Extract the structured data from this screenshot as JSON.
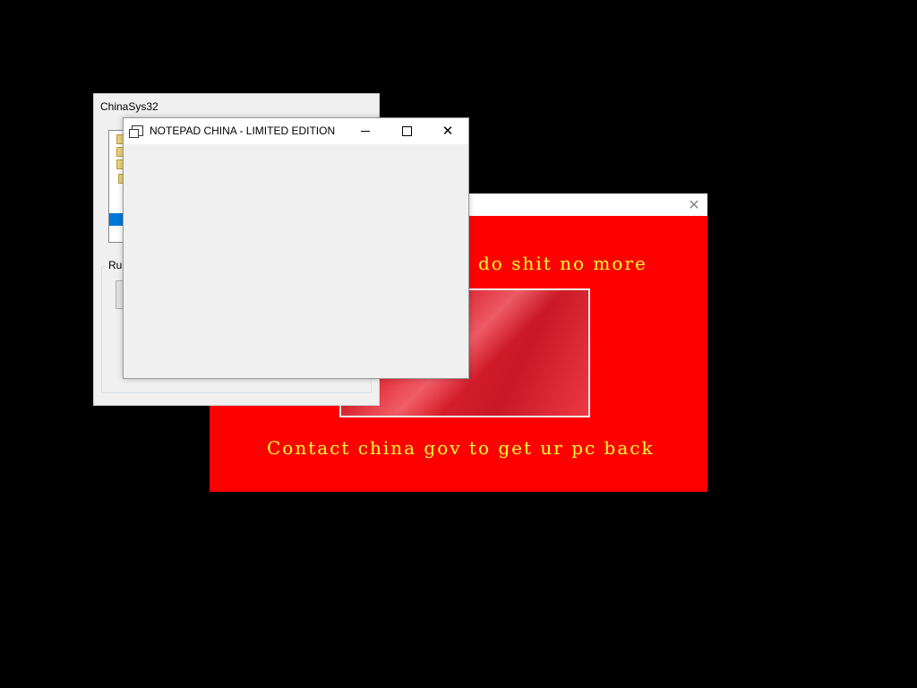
{
  "ransom_window": {
    "close_glyph": "✕",
    "line1": "do shit no more",
    "line2": "Contact china gov to get ur pc back",
    "text_color": "#ffff33",
    "background_color": "#ff0000"
  },
  "chinasys_window": {
    "title": "ChinaSys32",
    "group_label": "Rur"
  },
  "notepad_window": {
    "title": "NOTEPAD CHINA - LIMITED EDITION",
    "close_glyph": "✕"
  },
  "icons": {
    "notepad_app": "notepad-icon",
    "folder": "folder-icon",
    "minimize": "minimize-icon",
    "maximize": "maximize-icon",
    "close": "close-icon"
  }
}
